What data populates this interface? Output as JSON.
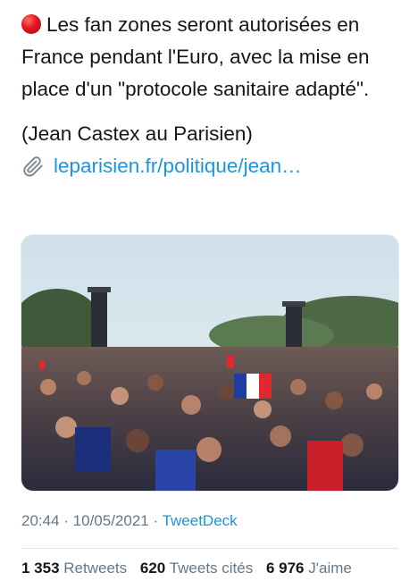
{
  "tweet": {
    "line1": "Les fan zones seront autorisées en France pendant l'Euro, avec la mise en place d'un \"protocole sanitaire adapté\".",
    "source": "(Jean Castex au Parisien)",
    "link": "leparisien.fr/politique/jean…"
  },
  "photo": {
    "icon": "crowd-photo",
    "accent": "#1b95e0"
  },
  "meta": {
    "time": "20:44",
    "separator1": " · ",
    "date": "10/05/2021",
    "separator2": " · ",
    "client": "TweetDeck"
  },
  "stats": {
    "retweets_count": "1 353",
    "retweets_label": "Retweets",
    "quotes_count": "620",
    "quotes_label": "Tweets cités",
    "likes_count": "6 976",
    "likes_label": "J'aime"
  },
  "colors": {
    "link": "#1b95e0",
    "muted": "#657786",
    "text": "#14171a",
    "red_dot": "#e0151a"
  }
}
